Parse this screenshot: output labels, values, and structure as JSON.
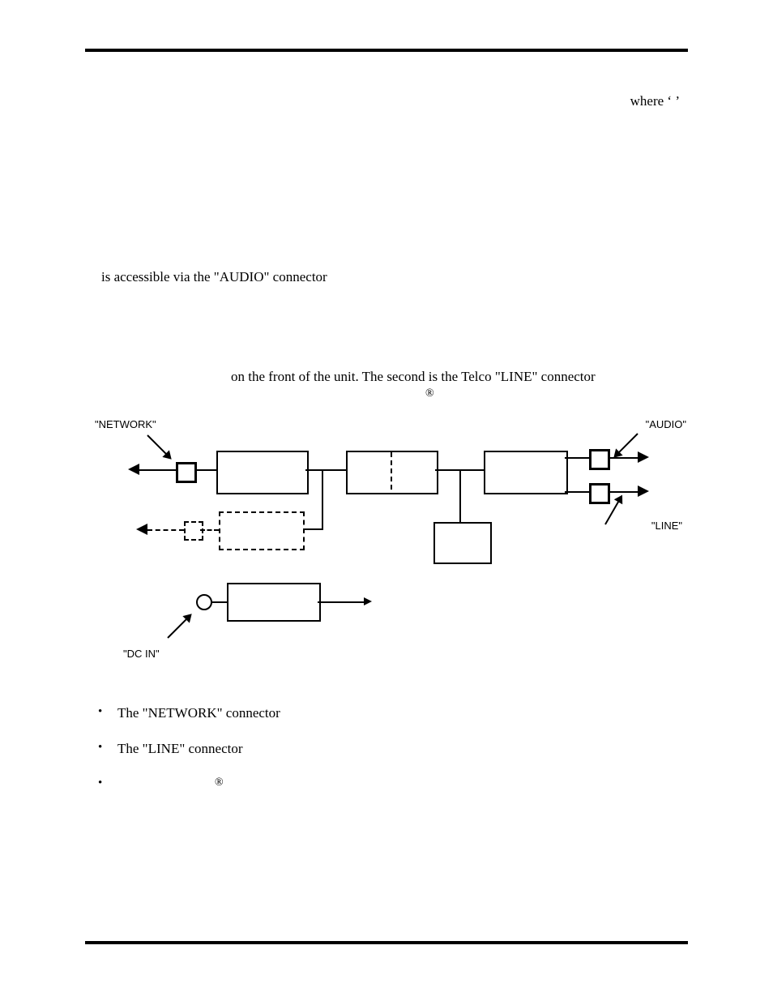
{
  "paragraphs": {
    "wherex": "where  ‘ ’",
    "audio_line": "is  accessible  via  the  \"AUDIO\"  connector",
    "front_line": "on  the  front  of  the  unit.    The  second  is  the  Telco  \"LINE\"  connector"
  },
  "diagram": {
    "labels": {
      "network": "\"NETWORK\"",
      "audio": "\"AUDIO\"",
      "line": "\"LINE\"",
      "dcin": "\"DC IN\""
    }
  },
  "bullets": {
    "b1": "The  \"NETWORK\"  connector",
    "b2": "The \"LINE\" connector"
  },
  "symbols": {
    "reg": "®"
  }
}
